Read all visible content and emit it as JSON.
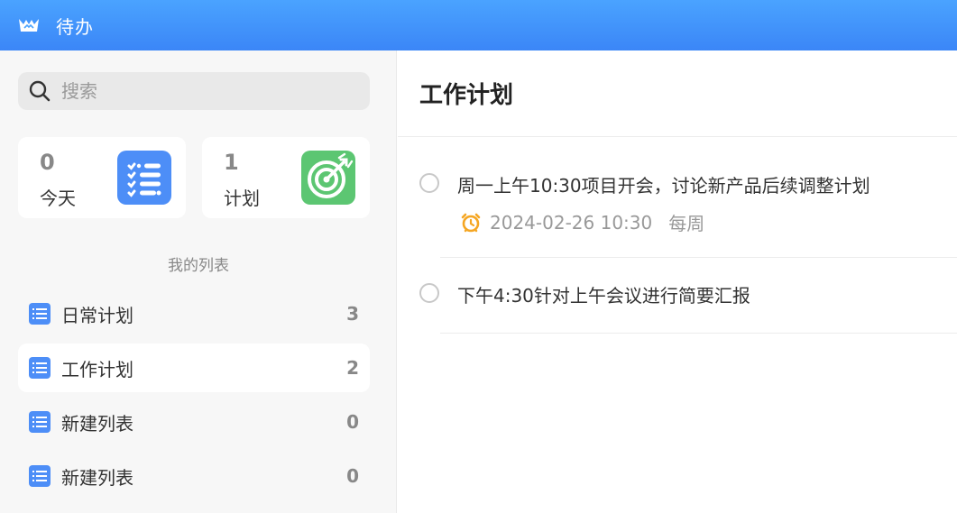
{
  "titlebar": {
    "app_title": "待办",
    "logo_icon": "crown-icon"
  },
  "sidebar": {
    "search": {
      "placeholder": "搜索",
      "value": ""
    },
    "cards": [
      {
        "count": "0",
        "label": "今天",
        "icon": "checklist-icon",
        "color": "#4d8ef7"
      },
      {
        "count": "1",
        "label": "计划",
        "icon": "target-icon",
        "color": "#5cc672"
      }
    ],
    "section_title": "我的列表",
    "lists": [
      {
        "name": "日常计划",
        "count": "3",
        "active": false
      },
      {
        "name": "工作计划",
        "count": "2",
        "active": true
      },
      {
        "name": "新建列表",
        "count": "0",
        "active": false
      },
      {
        "name": "新建列表",
        "count": "0",
        "active": false
      }
    ]
  },
  "main": {
    "title": "工作计划",
    "tasks": [
      {
        "text": "周一上午10:30项目开会，讨论新产品后续调整计划",
        "due": "2024-02-26 10:30",
        "repeat": "每周"
      },
      {
        "text": "下午4:30针对上午会议进行简要汇报"
      }
    ]
  },
  "colors": {
    "accent": "#3b86f7",
    "list_icon": "#4d8ef7",
    "alarm": "#f5a623"
  }
}
